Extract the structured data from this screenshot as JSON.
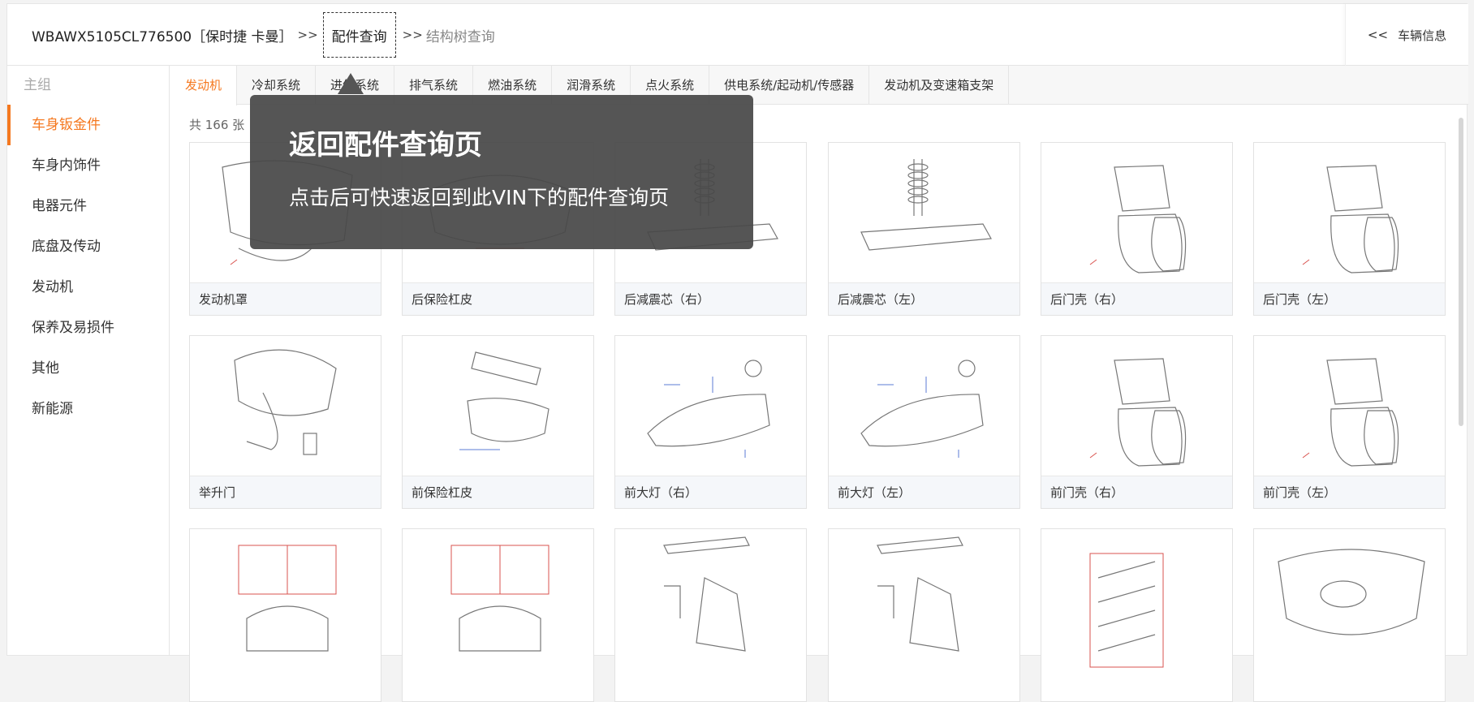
{
  "header": {
    "vin_label": "WBAWX5105CL776500［保时捷 卡曼］",
    "separator": ">>",
    "current": "配件查询",
    "next": "结构树查询",
    "vehicle_info": "车辆信息",
    "vehicle_info_prefix": "<<"
  },
  "sidebar": {
    "title": "主组",
    "items": [
      {
        "label": "车身钣金件"
      },
      {
        "label": "车身内饰件"
      },
      {
        "label": "电器元件"
      },
      {
        "label": "底盘及传动"
      },
      {
        "label": "发动机"
      },
      {
        "label": "保养及易损件"
      },
      {
        "label": "其他"
      },
      {
        "label": "新能源"
      }
    ]
  },
  "tabs": [
    {
      "label": "发动机"
    },
    {
      "label": "冷却系统"
    },
    {
      "label": "进气系统"
    },
    {
      "label": "排气系统"
    },
    {
      "label": "燃油系统"
    },
    {
      "label": "润滑系统"
    },
    {
      "label": "点火系统"
    },
    {
      "label": "供电系统/起动机/传感器"
    },
    {
      "label": "发动机及变速箱支架"
    }
  ],
  "content": {
    "count_text": "共 166 张",
    "cards": [
      {
        "label": "发动机罩",
        "icon": "hood-diagram-icon"
      },
      {
        "label": "后保险杠皮",
        "icon": "rear-bumper-diagram-icon"
      },
      {
        "label": "后减震芯（右）",
        "icon": "rear-shock-right-diagram-icon"
      },
      {
        "label": "后减震芯（左）",
        "icon": "rear-shock-left-diagram-icon"
      },
      {
        "label": "后门壳（右）",
        "icon": "rear-door-right-diagram-icon"
      },
      {
        "label": "后门壳（左）",
        "icon": "rear-door-left-diagram-icon"
      },
      {
        "label": "举升门",
        "icon": "liftgate-diagram-icon"
      },
      {
        "label": "前保险杠皮",
        "icon": "front-bumper-diagram-icon"
      },
      {
        "label": "前大灯（右）",
        "icon": "headlamp-right-diagram-icon"
      },
      {
        "label": "前大灯（左）",
        "icon": "headlamp-left-diagram-icon"
      },
      {
        "label": "前门壳（右）",
        "icon": "front-door-right-diagram-icon"
      },
      {
        "label": "前门壳（左）",
        "icon": "front-door-left-diagram-icon"
      },
      {
        "label": "",
        "icon": "wheelhouse-diagram-icon"
      },
      {
        "label": "",
        "icon": "wheelhouse-diagram-icon"
      },
      {
        "label": "",
        "icon": "taillamp-diagram-icon"
      },
      {
        "label": "",
        "icon": "taillamp-diagram-icon"
      },
      {
        "label": "",
        "icon": "wiring-diagram-icon"
      },
      {
        "label": "",
        "icon": "grille-diagram-icon"
      }
    ]
  },
  "tooltip": {
    "title": "返回配件查询页",
    "text": "点击后可快速返回到此VIN下的配件查询页"
  },
  "colors": {
    "accent": "#f5781f",
    "tooltip_bg": "#484848"
  }
}
